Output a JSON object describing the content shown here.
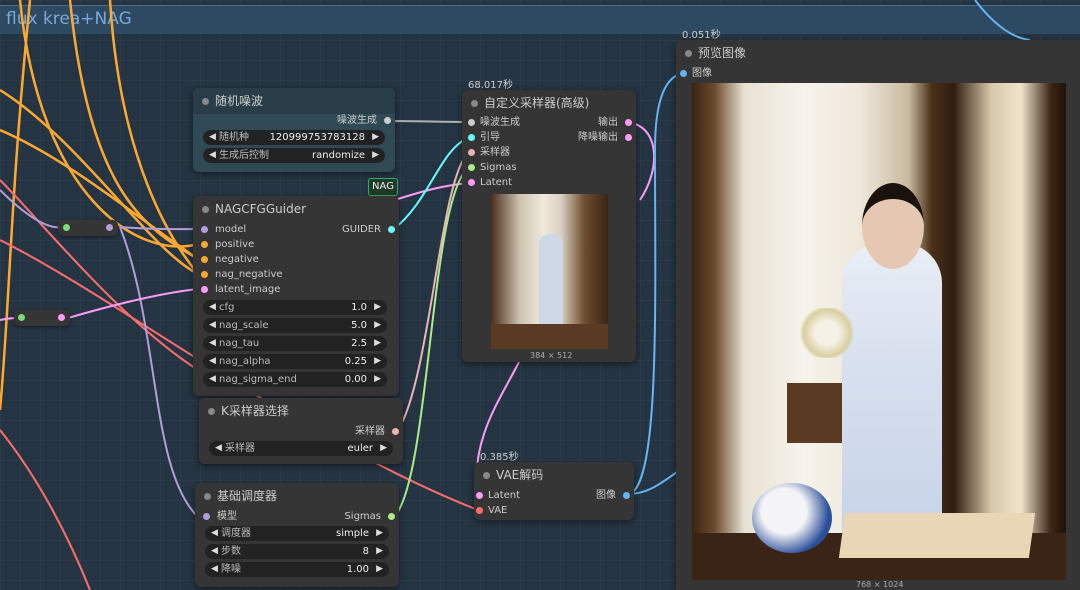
{
  "group": {
    "title": "flux krea+NAG"
  },
  "nodes": {
    "noise": {
      "title": "随机噪波",
      "output": "噪波生成",
      "seed_label": "随机种",
      "seed_value": "120999753783128",
      "control_label": "生成后控制",
      "control_value": "randomize"
    },
    "nag_tag": "NAG",
    "guider": {
      "title": "NAGCFGGuider",
      "inputs": [
        "model",
        "positive",
        "negative",
        "nag_negative",
        "latent_image"
      ],
      "output": "GUIDER",
      "widgets": [
        {
          "label": "cfg",
          "value": "1.0"
        },
        {
          "label": "nag_scale",
          "value": "5.0"
        },
        {
          "label": "nag_tau",
          "value": "2.5"
        },
        {
          "label": "nag_alpha",
          "value": "0.25"
        },
        {
          "label": "nag_sigma_end",
          "value": "0.00"
        }
      ]
    },
    "ksel": {
      "title": "K采样器选择",
      "output": "采样器",
      "widget_label": "采样器",
      "widget_value": "euler"
    },
    "sched": {
      "title": "基础调度器",
      "input": "模型",
      "output": "Sigmas",
      "widgets": [
        {
          "label": "调度器",
          "value": "simple"
        },
        {
          "label": "步数",
          "value": "8"
        },
        {
          "label": "降噪",
          "value": "1.00"
        }
      ]
    },
    "sampler": {
      "title": "自定义采样器(高级)",
      "time": "68.017秒",
      "inputs": [
        "噪波生成",
        "引导",
        "采样器",
        "Sigmas",
        "Latent"
      ],
      "outputs": [
        "输出",
        "降噪输出"
      ],
      "image_size": "384 × 512"
    },
    "vae": {
      "title": "VAE解码",
      "time": "0.385秒",
      "inputs": [
        "Latent",
        "VAE"
      ],
      "output": "图像"
    },
    "preview": {
      "title": "预览图像",
      "time": "0.051秒",
      "input": "图像",
      "image_size": "768 × 1024"
    }
  },
  "colors": {
    "float": "#aaee88",
    "sigmas": "#aaee88",
    "latent": "#ff9cf9",
    "model": "#b39ddb",
    "conditioning": "#ffa931",
    "image": "#64b5f6",
    "vae": "#ff6e6e",
    "noise": "#b0b0b0",
    "sampler": "#ecb4b4",
    "guider": "#66ffff"
  }
}
